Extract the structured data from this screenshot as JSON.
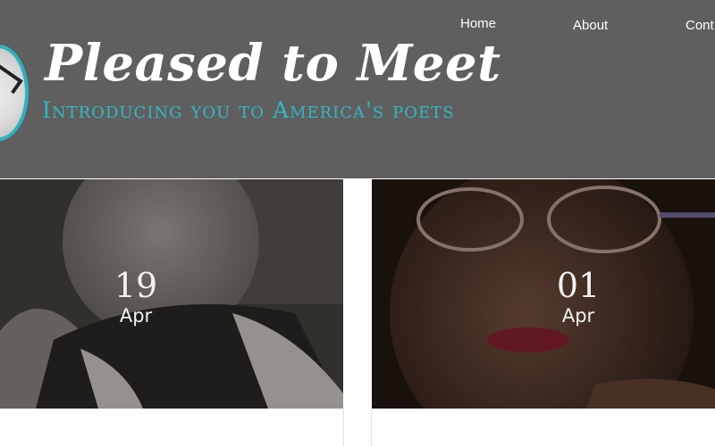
{
  "nav": {
    "items": [
      {
        "label": "Home"
      },
      {
        "label": "About"
      },
      {
        "label": "Cont"
      }
    ]
  },
  "site": {
    "title": "Pleased to Meet",
    "tagline": "Introducing you to America's poets"
  },
  "posts": [
    {
      "day": "19",
      "month": "Apr"
    },
    {
      "day": "01",
      "month": "Apr"
    }
  ],
  "colors": {
    "header_bg": "#5f5f5f",
    "accent": "#35b6c2"
  }
}
